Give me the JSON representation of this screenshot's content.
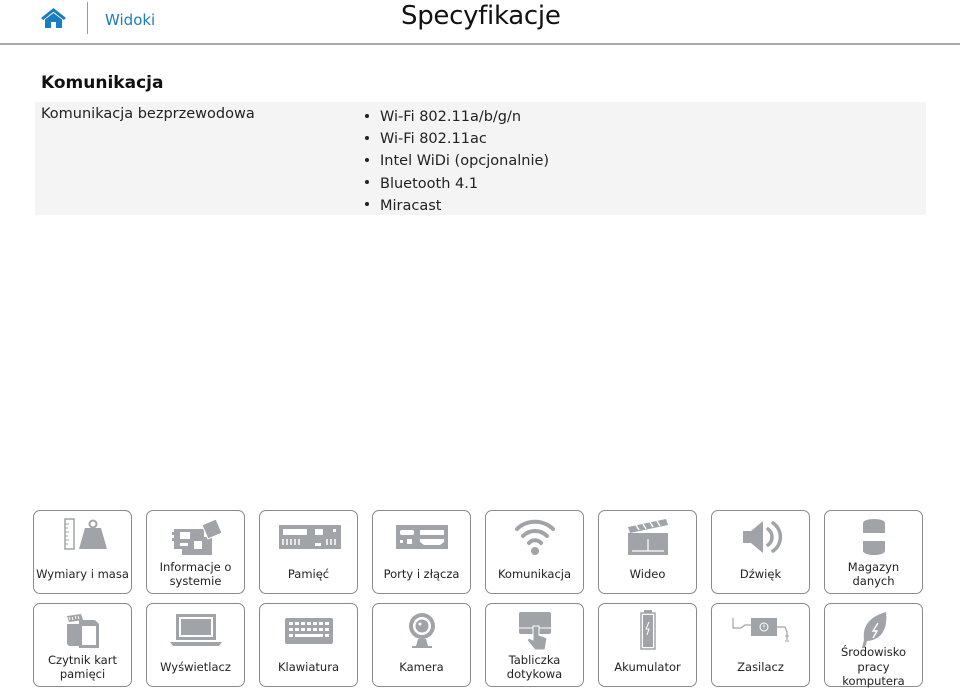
{
  "header": {
    "home_icon": "home-icon",
    "nav_link": "Widoki",
    "title": "Specyfikacje",
    "accent_color": "#1a7cc1"
  },
  "section": {
    "title": "Komunikacja",
    "rows": [
      {
        "label": "Komunikacja bezprzewodowa",
        "values": [
          "Wi-Fi 802.11a/b/g/n",
          "Wi-Fi 802.11ac",
          "Intel WiDi (opcjonalnie)",
          "Bluetooth 4.1",
          "Miracast"
        ]
      }
    ]
  },
  "tiles": {
    "row1": [
      {
        "label": "Wymiary i masa",
        "icon": "ruler-weight-icon"
      },
      {
        "label": "Informacje o systemie",
        "icon": "motherboard-icon"
      },
      {
        "label": "Pamięć",
        "icon": "memory-module-icon"
      },
      {
        "label": "Porty i złącza",
        "icon": "ports-icon"
      },
      {
        "label": "Komunikacja",
        "icon": "wifi-icon"
      },
      {
        "label": "Wideo",
        "icon": "clapperboard-icon"
      },
      {
        "label": "Dźwięk",
        "icon": "speaker-icon"
      },
      {
        "label": "Magazyn danych",
        "icon": "storage-drive-icon"
      }
    ],
    "row2": [
      {
        "label": "Czytnik kart pamięci",
        "icon": "memory-card-icon"
      },
      {
        "label": "Wyświetlacz",
        "icon": "laptop-display-icon"
      },
      {
        "label": "Klawiatura",
        "icon": "keyboard-icon"
      },
      {
        "label": "Kamera",
        "icon": "webcam-icon"
      },
      {
        "label": "Tabliczka dotykowa",
        "icon": "touchpad-icon"
      },
      {
        "label": "Akumulator",
        "icon": "battery-icon"
      },
      {
        "label": "Zasilacz",
        "icon": "power-adapter-icon"
      },
      {
        "label": "Środowisko pracy komputera",
        "icon": "eco-leaf-icon"
      }
    ]
  }
}
